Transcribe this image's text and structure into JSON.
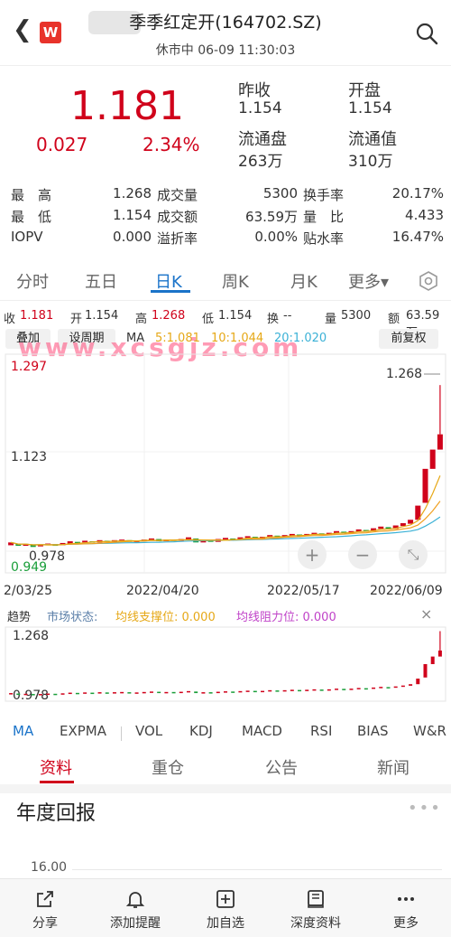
{
  "header": {
    "title": "季季红定开(164702.SZ)",
    "subtitle": "休市中 06-09 11:30:03",
    "logo": "W"
  },
  "quote": {
    "price": "1.181",
    "change": "0.027",
    "change_pct": "2.34%",
    "prev_close_label": "昨收",
    "prev_close": "1.154",
    "open_label": "开盘",
    "open": "1.154",
    "float_shares_label": "流通盘",
    "float_shares": "263万",
    "float_value_label": "流通值",
    "float_value": "310万"
  },
  "stats": [
    {
      "l1": "最　高",
      "v1": "1.268",
      "l2": "成交量",
      "v2": "5300",
      "l3": "换手率",
      "v3": "20.17%"
    },
    {
      "l1": "最　低",
      "v1": "1.154",
      "l2": "成交额",
      "v2": "63.59万",
      "l3": "量　比",
      "v3": "4.433"
    },
    {
      "l1": "IOPV",
      "v1": "0.000",
      "l2": "溢折率",
      "v2": "0.00%",
      "l3": "贴水率",
      "v3": "16.47%"
    }
  ],
  "period_tabs": [
    "分时",
    "五日",
    "日K",
    "周K",
    "月K",
    "更多▾"
  ],
  "ohlc": {
    "close_label": "收",
    "close": "1.181",
    "open_label": "开",
    "open": "1.154",
    "high_label": "高",
    "high": "1.268",
    "low_label": "低",
    "low": "1.154",
    "turnover_label": "换",
    "turnover": "--",
    "volume_label": "量",
    "volume": "5300",
    "amount_label": "额",
    "amount": "63.59万"
  },
  "toolbar": {
    "overlay": "叠加",
    "set_period": "设周期",
    "ma_label": "MA",
    "ma5": "5:1.081",
    "ma10": "10:1.044",
    "ma20": "20:1.020",
    "adjust": "前复权"
  },
  "watermark": "www.xcsgjz.com",
  "chart_data": {
    "type": "candlestick",
    "y_labels": [
      "1.297",
      "1.123",
      "0.978",
      "0.949"
    ],
    "max_label": "1.268",
    "x_labels": [
      "2/03/25",
      "2022/04/20",
      "2022/05/17",
      "2022/06/09"
    ],
    "ylim": [
      0.949,
      1.297
    ],
    "candles": [
      {
        "o": 0.985,
        "c": 0.99
      },
      {
        "o": 0.988,
        "c": 0.984
      },
      {
        "o": 0.984,
        "c": 0.987
      },
      {
        "o": 0.986,
        "c": 0.982
      },
      {
        "o": 0.983,
        "c": 0.986
      },
      {
        "o": 0.985,
        "c": 0.988
      },
      {
        "o": 0.987,
        "c": 0.984
      },
      {
        "o": 0.985,
        "c": 0.989
      },
      {
        "o": 0.988,
        "c": 0.992
      },
      {
        "o": 0.991,
        "c": 0.989
      },
      {
        "o": 0.99,
        "c": 0.993
      },
      {
        "o": 0.992,
        "c": 0.99
      },
      {
        "o": 0.99,
        "c": 0.994
      },
      {
        "o": 0.993,
        "c": 0.991
      },
      {
        "o": 0.991,
        "c": 0.994
      },
      {
        "o": 0.993,
        "c": 0.995
      },
      {
        "o": 0.994,
        "c": 0.991
      },
      {
        "o": 0.991,
        "c": 0.993
      },
      {
        "o": 0.992,
        "c": 0.995
      },
      {
        "o": 0.994,
        "c": 0.997
      },
      {
        "o": 0.996,
        "c": 0.992
      },
      {
        "o": 0.992,
        "c": 0.995
      },
      {
        "o": 0.995,
        "c": 0.993
      },
      {
        "o": 0.993,
        "c": 0.996
      },
      {
        "o": 0.995,
        "c": 0.999
      },
      {
        "o": 0.997,
        "c": 0.99
      },
      {
        "o": 0.99,
        "c": 0.994
      },
      {
        "o": 0.994,
        "c": 0.991
      },
      {
        "o": 0.991,
        "c": 0.996
      },
      {
        "o": 0.995,
        "c": 0.998
      },
      {
        "o": 0.997,
        "c": 0.994
      },
      {
        "o": 0.995,
        "c": 0.999
      },
      {
        "o": 0.998,
        "c": 1.001
      },
      {
        "o": 1.0,
        "c": 0.997
      },
      {
        "o": 0.997,
        "c": 1.0
      },
      {
        "o": 0.999,
        "c": 1.003
      },
      {
        "o": 1.002,
        "c": 0.999
      },
      {
        "o": 0.999,
        "c": 1.003
      },
      {
        "o": 1.002,
        "c": 1.005
      },
      {
        "o": 1.004,
        "c": 1.001
      },
      {
        "o": 1.001,
        "c": 1.005
      },
      {
        "o": 1.004,
        "c": 1.007
      },
      {
        "o": 1.006,
        "c": 1.003
      },
      {
        "o": 1.003,
        "c": 1.007
      },
      {
        "o": 1.006,
        "c": 1.01
      },
      {
        "o": 1.009,
        "c": 1.006
      },
      {
        "o": 1.006,
        "c": 1.01
      },
      {
        "o": 1.009,
        "c": 1.013
      },
      {
        "o": 1.012,
        "c": 1.009
      },
      {
        "o": 1.01,
        "c": 1.015
      },
      {
        "o": 1.014,
        "c": 1.018
      },
      {
        "o": 1.017,
        "c": 1.013
      },
      {
        "o": 1.014,
        "c": 1.02
      },
      {
        "o": 1.019,
        "c": 1.024
      },
      {
        "o": 1.023,
        "c": 1.03
      },
      {
        "o": 1.03,
        "c": 1.055
      },
      {
        "o": 1.06,
        "c": 1.12
      },
      {
        "o": 1.12,
        "c": 1.154
      },
      {
        "o": 1.154,
        "c": 1.181
      }
    ],
    "high_wick": 1.268,
    "ma5_end": "1.081",
    "ma10_end": "1.044",
    "ma20_end": "1.020"
  },
  "trend_bar": {
    "title": "趋势",
    "status": "市场状态:",
    "support": "均线支撑位: 0.000",
    "resistance": "均线阻力位: 0.000"
  },
  "mini_chart": {
    "top_label": "1.268",
    "bottom_label": "0.978"
  },
  "indicator_tabs": [
    "MA",
    "EXPMA",
    "VOL",
    "KDJ",
    "MACD",
    "RSI",
    "BIAS",
    "W&R"
  ],
  "section_tabs": [
    "资料",
    "重仓",
    "公告",
    "新闻"
  ],
  "annual": {
    "title": "年度回报",
    "axis_top": "16.00"
  },
  "bottom_bar": [
    {
      "label": "分享",
      "icon": "share-icon"
    },
    {
      "label": "添加提醒",
      "icon": "bell-icon"
    },
    {
      "label": "加自选",
      "icon": "add-watchlist-icon"
    },
    {
      "label": "深度资料",
      "icon": "book-icon"
    },
    {
      "label": "更多",
      "icon": "more-icon"
    }
  ],
  "colors": {
    "up": "#d0021b",
    "down": "#1a9e3a",
    "accent": "#1a73c9",
    "ma5": "#e6a817",
    "ma10": "#e6a817",
    "ma20": "#3bb1d6"
  }
}
